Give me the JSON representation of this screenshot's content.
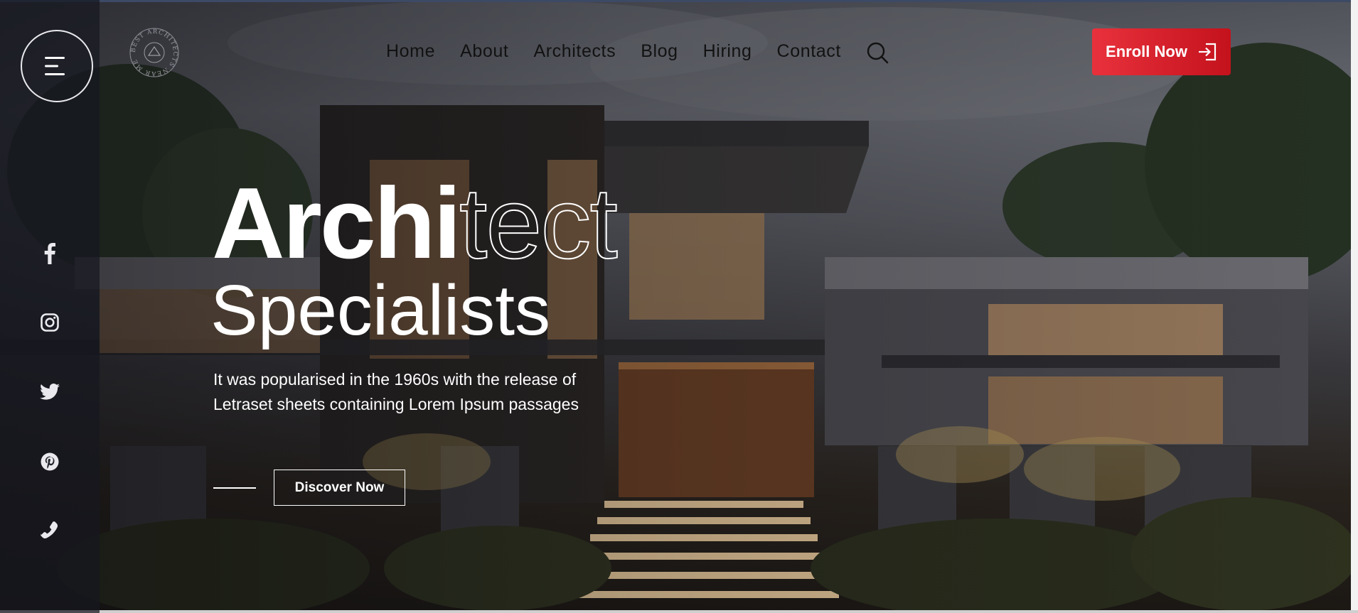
{
  "brand": {
    "logo_icon": "circular-seal-logo-icon",
    "logo_text": "BEST ARCHITECTS NEAR ME"
  },
  "nav": {
    "items": [
      {
        "label": "Home"
      },
      {
        "label": "About"
      },
      {
        "label": "Architects"
      },
      {
        "label": "Blog"
      },
      {
        "label": "Hiring"
      },
      {
        "label": "Contact"
      }
    ],
    "search_icon": "search-icon"
  },
  "cta": {
    "enroll_label": "Enroll Now",
    "enroll_icon": "sign-in-arrow-icon",
    "accent_color": "#e02a33"
  },
  "sidebar": {
    "menu_icon": "hamburger-menu-icon",
    "social": [
      {
        "icon": "facebook-icon"
      },
      {
        "icon": "instagram-icon"
      },
      {
        "icon": "twitter-icon"
      },
      {
        "icon": "pinterest-icon"
      },
      {
        "icon": "phone-icon"
      }
    ]
  },
  "hero": {
    "title_solid": "Archi",
    "title_outline": "tect",
    "subtitle": "Specialists",
    "description": "It was popularised in the 1960s with the release of Letraset sheets containing Lorem Ipsum passages",
    "button_label": "Discover Now"
  }
}
